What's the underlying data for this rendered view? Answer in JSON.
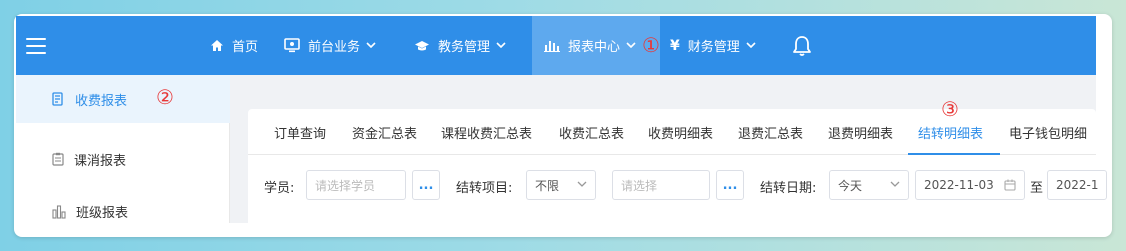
{
  "nav": {
    "items": [
      {
        "label": "首页",
        "icon": "home-icon"
      },
      {
        "label": "前台业务",
        "icon": "monitor-icon"
      },
      {
        "label": "教务管理",
        "icon": "graduation-cap-icon"
      },
      {
        "label": "报表中心",
        "icon": "bar-chart-icon"
      },
      {
        "label": "财务管理",
        "icon": "yen-icon"
      }
    ],
    "annotation_1": "①"
  },
  "sidebar": {
    "items": [
      {
        "label": "收费报表",
        "icon": "receipt-icon"
      },
      {
        "label": "课消报表",
        "icon": "clipboard-icon"
      },
      {
        "label": "班级报表",
        "icon": "class-chart-icon"
      }
    ],
    "annotation_2": "②"
  },
  "tabs": {
    "items": [
      "订单查询",
      "资金汇总表",
      "课程收费汇总表",
      "收费汇总表",
      "收费明细表",
      "退费汇总表",
      "退费明细表",
      "结转明细表",
      "电子钱包明细"
    ],
    "active_index": 7,
    "annotation_3": "③"
  },
  "filters": {
    "student_label": "学员:",
    "student_placeholder": "请选择学员",
    "more_button": "...",
    "transfer_item_label": "结转项目:",
    "transfer_item_value": "不限",
    "select_placeholder": "请选择",
    "transfer_date_label": "结转日期:",
    "date_range_value": "今天",
    "start_date": "2022-11-03",
    "to_label": "至",
    "end_date": "2022-1"
  },
  "colors": {
    "nav_bg": "#2f8ee8",
    "nav_active": "#5ea9ee",
    "accent": "#2f8ee8",
    "annotation": "#e83838"
  }
}
